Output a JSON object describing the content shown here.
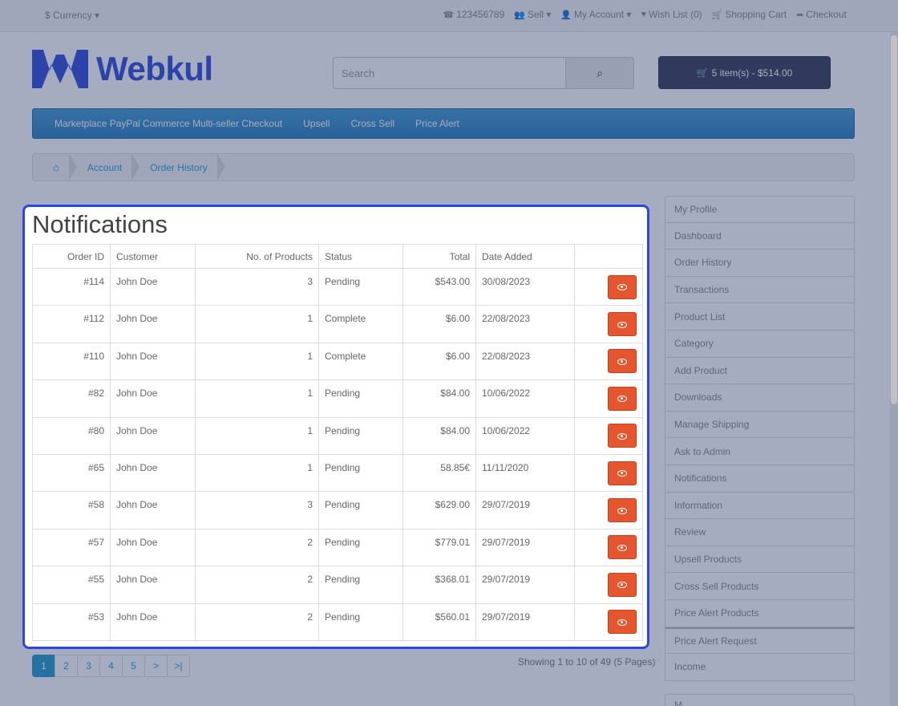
{
  "topbar": {
    "currency": "$ Currency ▾",
    "phone": "123456789",
    "sell": "Sell ▾",
    "my_account": "My Account ▾",
    "wishlist": "Wish List (0)",
    "shopping_cart": "Shopping Cart",
    "checkout": "Checkout"
  },
  "header": {
    "logo_text": "Webkul",
    "search_placeholder": "Search",
    "cart_label": "5 item(s) - $514.00"
  },
  "nav": {
    "items": [
      "Marketplace PayPal Commerce Multi-seller Checkout",
      "Upsell",
      "Cross Sell",
      "Price Alert"
    ]
  },
  "breadcrumb": {
    "items": [
      "Account",
      "Order History"
    ]
  },
  "main": {
    "title": "Notifications",
    "columns": [
      "Order ID",
      "Customer",
      "No. of Products",
      "Status",
      "Total",
      "Date Added",
      ""
    ],
    "rows": [
      {
        "order_id": "#114",
        "customer": "John Doe",
        "products": "3",
        "status": "Pending",
        "total": "$543.00",
        "date": "30/08/2023"
      },
      {
        "order_id": "#112",
        "customer": "John Doe",
        "products": "1",
        "status": "Complete",
        "total": "$6.00",
        "date": "22/08/2023"
      },
      {
        "order_id": "#110",
        "customer": "John Doe",
        "products": "1",
        "status": "Complete",
        "total": "$6.00",
        "date": "22/08/2023"
      },
      {
        "order_id": "#82",
        "customer": "John Doe",
        "products": "1",
        "status": "Pending",
        "total": "$84.00",
        "date": "10/06/2022"
      },
      {
        "order_id": "#80",
        "customer": "John Doe",
        "products": "1",
        "status": "Pending",
        "total": "$84.00",
        "date": "10/06/2022"
      },
      {
        "order_id": "#65",
        "customer": "John Doe",
        "products": "1",
        "status": "Pending",
        "total": "58.85€",
        "date": "11/11/2020"
      },
      {
        "order_id": "#58",
        "customer": "John Doe",
        "products": "3",
        "status": "Pending",
        "total": "$629.00",
        "date": "29/07/2019"
      },
      {
        "order_id": "#57",
        "customer": "John Doe",
        "products": "2",
        "status": "Pending",
        "total": "$779.01",
        "date": "29/07/2019"
      },
      {
        "order_id": "#55",
        "customer": "John Doe",
        "products": "2",
        "status": "Pending",
        "total": "$368.01",
        "date": "29/07/2019"
      },
      {
        "order_id": "#53",
        "customer": "John Doe",
        "products": "2",
        "status": "Pending",
        "total": "$560.01",
        "date": "29/07/2019"
      }
    ]
  },
  "pagination": {
    "pages": [
      "1",
      "2",
      "3",
      "4",
      "5",
      ">",
      ">|"
    ],
    "active": "1",
    "summary": "Showing 1 to 10 of 49 (5 Pages)"
  },
  "sidebar": {
    "items": [
      "My Profile",
      "Dashboard",
      "Order History",
      "Transactions",
      "Product List",
      "Category",
      "Add Product",
      "Downloads",
      "Manage Shipping",
      "Ask to Admin",
      "Notifications",
      "Information",
      "Review",
      "Upsell Products",
      "Cross Sell Products",
      "Price Alert Products",
      "Price Alert Request",
      "Income"
    ],
    "second_box_label": "M..."
  },
  "colors": {
    "accent_blue": "#2b47e0",
    "nav_blue": "#2a80bd",
    "view_button": "#e4562e",
    "logo_blue": "#2d4bd9"
  }
}
